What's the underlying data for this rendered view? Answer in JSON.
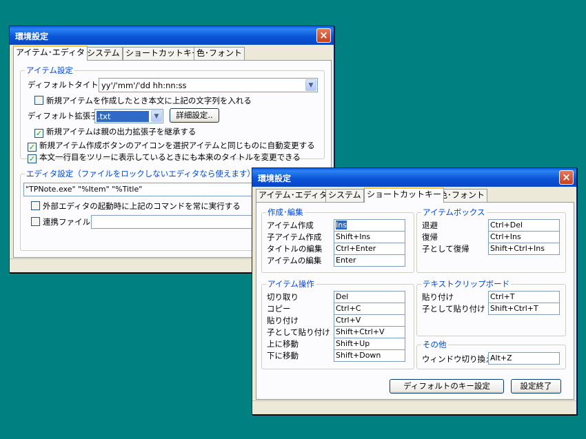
{
  "colors": {
    "desktop": "#008080",
    "titlebar": "#0B56D8",
    "accent_group": "#0046D5",
    "dialog": "#ECE9D8"
  },
  "win1": {
    "title": "環境設定",
    "close_icon": "×",
    "tabs": [
      "アイテム･エディタ",
      "システム",
      "ショートカットキー",
      "色･フォント"
    ],
    "active_tab": 0,
    "item_group": {
      "legend": "アイテム設定",
      "default_title_label": "ディフォルトタイトル",
      "default_title_value": "yy'/'mm'/'dd hh:nn:ss",
      "chk_insert_text": "新規アイテムを作成したとき本文に上記の文字列を入れる",
      "default_ext_label": "ディフォルト拡張子",
      "default_ext_value": ".txt",
      "detail_button": "詳細設定..",
      "chk_inherit_ext": "新規アイテムは親の出力拡張子を継承する",
      "chk_icon_change": "新規アイテム作成ボタンのアイコンを選択アイテムと同じものに自動変更する",
      "chk_first_line_title": "本文一行目をツリーに表示しているときにも本来のタイトルを変更できる"
    },
    "editor_group": {
      "legend": "エディタ設定（ファイルをロックしないエディタなら使えます）",
      "command": "\"TPNote.exe\" \"%Item\" \"%Title\"",
      "chk_always_run": "外部エディタの起動時に上記のコマンドを常に実行する",
      "chk_linked_file": "連携ファイル"
    }
  },
  "win2": {
    "title": "環境設定",
    "close_icon": "×",
    "tabs": [
      "アイテム･エディタ",
      "システム",
      "ショートカットキー",
      "色･フォント"
    ],
    "active_tab": 2,
    "create_edit": {
      "legend": "作成･編集",
      "rows": [
        {
          "label": "アイテム作成",
          "key": "Ins"
        },
        {
          "label": "子アイテム作成",
          "key": "Shift+Ins"
        },
        {
          "label": "タイトルの編集",
          "key": "Ctrl+Enter"
        },
        {
          "label": "アイテムの編集",
          "key": "Enter"
        }
      ]
    },
    "item_box": {
      "legend": "アイテムボックス",
      "rows": [
        {
          "label": "退避",
          "key": "Ctrl+Del"
        },
        {
          "label": "復帰",
          "key": "Ctrl+Ins"
        },
        {
          "label": "子として復帰",
          "key": "Shift+Ctrl+Ins"
        }
      ]
    },
    "item_ops": {
      "legend": "アイテム操作",
      "rows": [
        {
          "label": "切り取り",
          "key": "Del"
        },
        {
          "label": "コピー",
          "key": "Ctrl+C"
        },
        {
          "label": "貼り付け",
          "key": "Ctrl+V"
        },
        {
          "label": "子として貼り付け",
          "key": "Shift+Ctrl+V"
        },
        {
          "label": "上に移動",
          "key": "Shift+Up"
        },
        {
          "label": "下に移動",
          "key": "Shift+Down"
        }
      ]
    },
    "text_clip": {
      "legend": "テキストクリップボード",
      "rows": [
        {
          "label": "貼り付け",
          "key": "Ctrl+T"
        },
        {
          "label": "子として貼り付け",
          "key": "Shift+Ctrl+T"
        }
      ]
    },
    "other": {
      "legend": "その他",
      "rows": [
        {
          "label": "ウィンドウ切り換え",
          "key": "Alt+Z"
        }
      ]
    },
    "default_keys_button": "ディフォルトのキー設定",
    "ok_button": "設定終了"
  }
}
